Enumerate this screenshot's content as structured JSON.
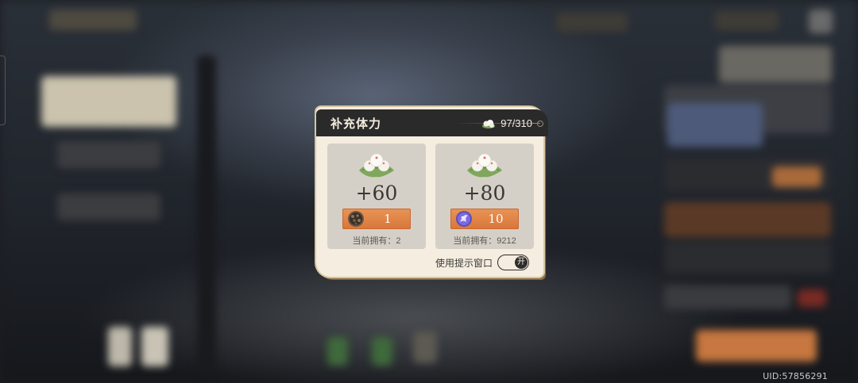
{
  "dialog": {
    "title": "补充体力",
    "stamina": "97/310",
    "options": [
      {
        "gain": "+60",
        "cost": "1",
        "cost_icon": "dark-ore-icon",
        "owned": "当前拥有：2"
      },
      {
        "gain": "+80",
        "cost": "10",
        "cost_icon": "purple-crystal-icon",
        "owned": "当前拥有：9212"
      }
    ],
    "prompt_label": "使用提示窗口",
    "toggle_label": "开"
  },
  "footer": {
    "uid": "UID:57856291"
  },
  "colors": {
    "header_bg": "#2b2a2b",
    "panel_bg": "#f4ede0",
    "card_bg": "#d5d0c7",
    "cost_button": "#e08546"
  }
}
